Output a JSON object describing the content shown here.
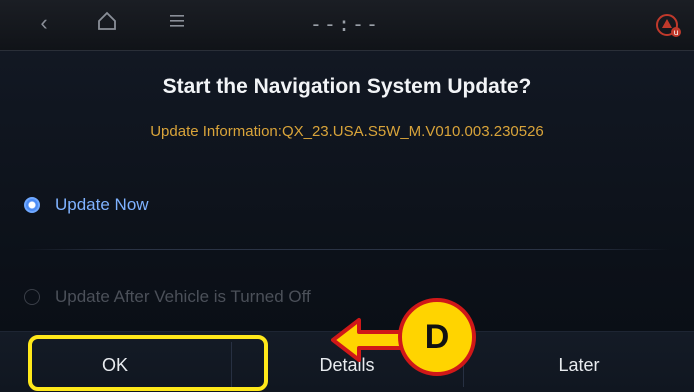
{
  "status_bar": {
    "back_icon": "chevron-left-icon",
    "home_icon": "home-icon",
    "menu_icon": "menu-icon",
    "clock": "--:--",
    "nav_status_icon": "navigation-update-icon"
  },
  "dialog": {
    "title": "Start the Navigation System Update?",
    "update_info": "Update Information:QX_23.USA.S5W_M.V010.003.230526",
    "options": [
      {
        "label": "Update Now",
        "selected": true
      },
      {
        "label": "Update After Vehicle is Turned Off",
        "selected": false
      }
    ],
    "buttons": {
      "ok": "OK",
      "details": "Details",
      "later": "Later"
    }
  },
  "annotation": {
    "callout_label": "D",
    "highlight_color": "#ffe81a",
    "callout_fill": "#ffd400",
    "callout_border": "#d01818"
  },
  "colors": {
    "selected_option": "#7fb2ff",
    "info_text": "#d9a43a"
  }
}
